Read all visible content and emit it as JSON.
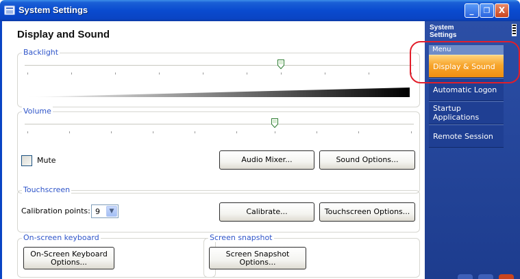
{
  "window": {
    "title": "System Settings",
    "controls": {
      "minimize": "_",
      "restore": "❐",
      "close": "X"
    }
  },
  "page": {
    "title": "Display and Sound"
  },
  "backlight": {
    "label": "Backlight",
    "level_fraction": 0.66
  },
  "volume": {
    "label": "Volume",
    "level_fraction": 0.64
  },
  "audio": {
    "mute_label": "Mute",
    "mute_checked": false,
    "audio_mixer_button": "Audio Mixer...",
    "sound_options_button": "Sound Options..."
  },
  "touchscreen": {
    "label": "Touchscreen",
    "calibration_label": "Calibration points:",
    "calibration_value": "9",
    "calibrate_button": "Calibrate...",
    "options_button": "Touchscreen Options..."
  },
  "keyboard": {
    "label": "On-screen keyboard",
    "options_button_line1": "On-Screen Keyboard",
    "options_button_line2": "Options..."
  },
  "snapshot": {
    "label": "Screen snapshot",
    "options_button": "Screen Snapshot Options..."
  },
  "sidebar": {
    "heading_line1": "System",
    "heading_line2": "Settings",
    "menu_header": "Menu",
    "items": [
      {
        "label": "Display & Sound",
        "active": true
      },
      {
        "label": "Automatic Logon",
        "active": false
      },
      {
        "label": "Startup Applications",
        "active": false
      },
      {
        "label": "Remote Session",
        "active": false
      }
    ]
  },
  "colors": {
    "titlebar": "#0a4bcf",
    "group_label": "#2f55c9",
    "active_menu": "#f7a52c",
    "annotation_ring": "#e21e2a"
  },
  "icons": [
    "app-icon",
    "minimize-icon",
    "restore-icon",
    "close-icon",
    "battery-icon",
    "chevron-down-icon"
  ]
}
